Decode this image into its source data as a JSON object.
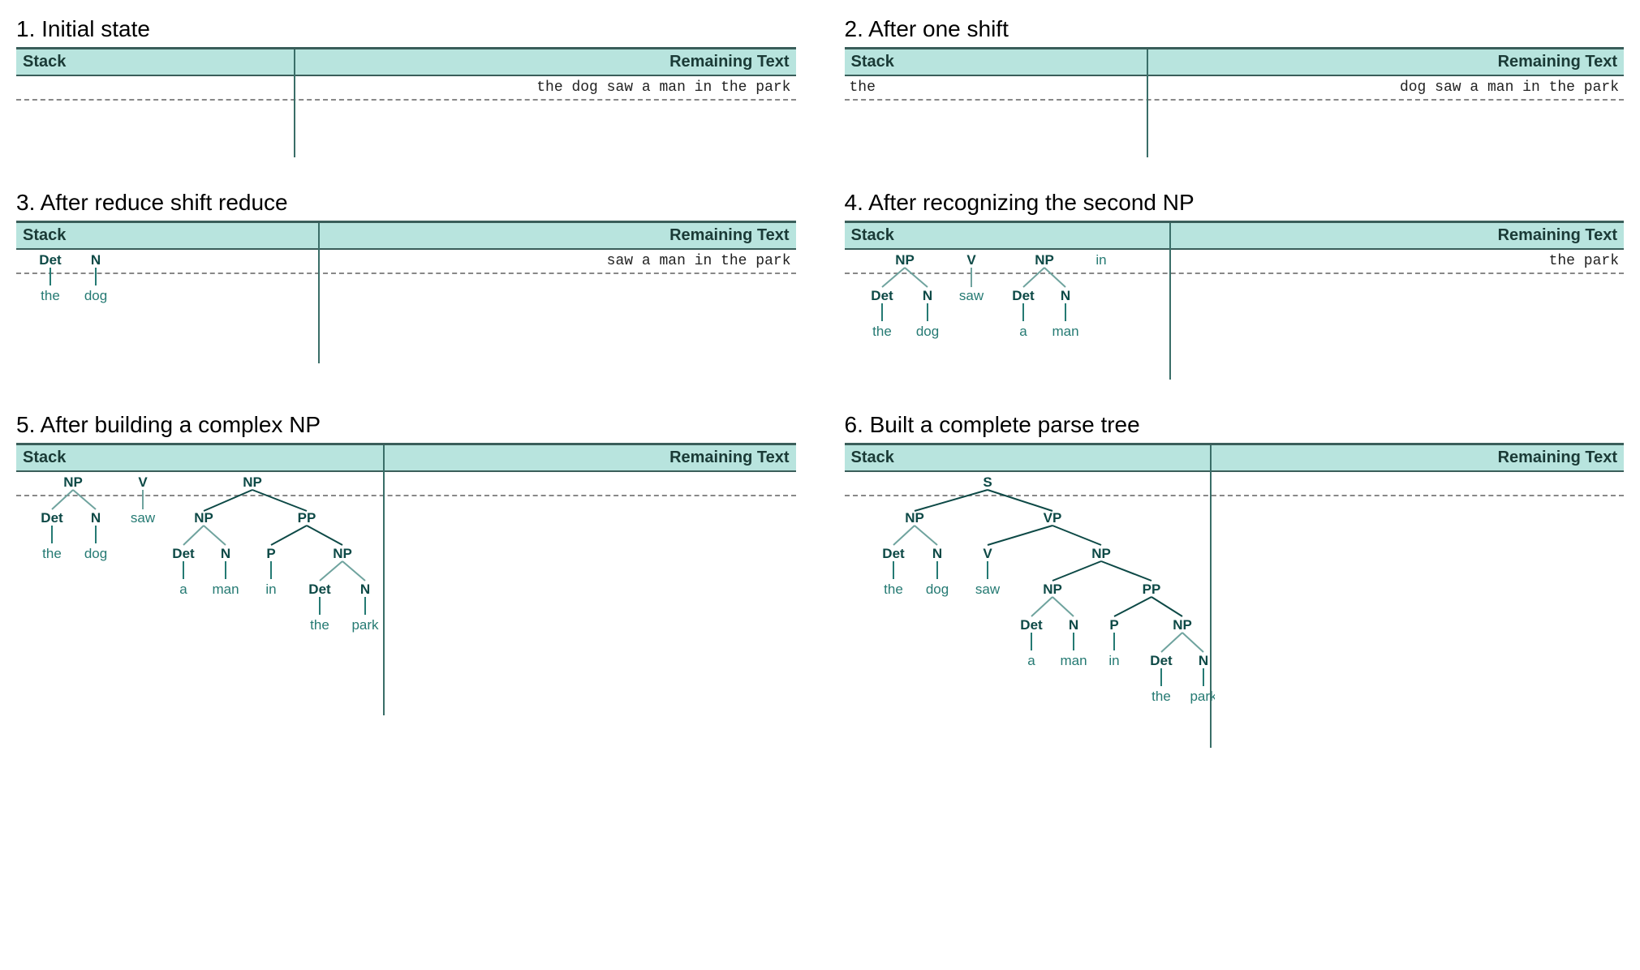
{
  "headerStack": "Stack",
  "headerRemaining": "Remaining Text",
  "labels": {
    "S": "S",
    "NP": "NP",
    "VP": "VP",
    "PP": "PP",
    "Det": "Det",
    "N": "N",
    "V": "V",
    "P": "P",
    "the": "the",
    "dog": "dog",
    "saw": "saw",
    "a": "a",
    "man": "man",
    "in": "in",
    "park": "park"
  },
  "panels": [
    {
      "num": "1",
      "title": "1. Initial state",
      "stackText": "",
      "remaining": "the dog saw a man in the park",
      "dividerLeft": 342,
      "tree": null,
      "minBody": 100
    },
    {
      "num": "2",
      "title": "2. After one shift",
      "stackText": "the",
      "remaining": "dog saw a man in the park",
      "dividerLeft": 372,
      "tree": null,
      "minBody": 100
    },
    {
      "num": "3",
      "title": "3. After reduce shift reduce",
      "stackText": "",
      "remaining": "saw a man in the park",
      "dividerLeft": 372,
      "minBody": 140,
      "tree": "tree3"
    },
    {
      "num": "4",
      "title": "4. After recognizing the second NP",
      "stackText": "",
      "remaining": "the park",
      "dividerLeft": 400,
      "minBody": 160,
      "tree": "tree4"
    },
    {
      "num": "5",
      "title": "5. After building a complex NP",
      "stackText": "",
      "remaining": "",
      "dividerLeft": 452,
      "minBody": 300,
      "tree": "tree5"
    },
    {
      "num": "6",
      "title": "6. Built a complete parse tree",
      "stackText": "",
      "remaining": "",
      "dividerLeft": 450,
      "minBody": 340,
      "tree": "tree6"
    }
  ]
}
